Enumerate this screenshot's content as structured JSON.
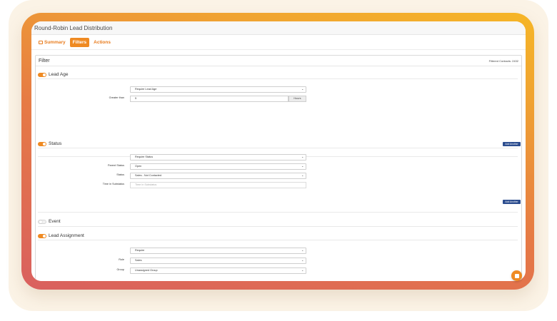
{
  "window": {
    "title": "Round-Robin Lead Distribution"
  },
  "tabs": [
    {
      "label": "Summary",
      "icon": "list-icon"
    },
    {
      "label": "Filters"
    },
    {
      "label": "Actions"
    }
  ],
  "filter": {
    "title": "Filter",
    "filtered_contacts": "Filtered Contacts: 2432",
    "lead_age": {
      "label": "Lead Age",
      "enabled": true,
      "require_select": "Require Lead Age",
      "greater_than_label": "Greater than",
      "greater_than_value": "5",
      "unit": "Hours",
      "add_another": "Add Another"
    },
    "status": {
      "label": "Status",
      "enabled": true,
      "require_select": "Require Status",
      "parent_status_label": "Parent Status",
      "parent_status_value": "Open",
      "status_label": "Status",
      "status_value": "Sales - Not Contacted",
      "time_label": "Time in Substatus",
      "time_placeholder": "Time in Substatus",
      "add_another": "Add Another"
    },
    "event": {
      "label": "Event",
      "enabled": false
    },
    "lead_assignment": {
      "label": "Lead Assignment",
      "enabled": true,
      "require_select": "Require",
      "role_label": "Role",
      "role_value": "Sales",
      "group_label": "Group",
      "group_value": "Unassigned Group"
    }
  },
  "colors": {
    "accent": "#ef8a22",
    "button": "#2c4d8f"
  }
}
